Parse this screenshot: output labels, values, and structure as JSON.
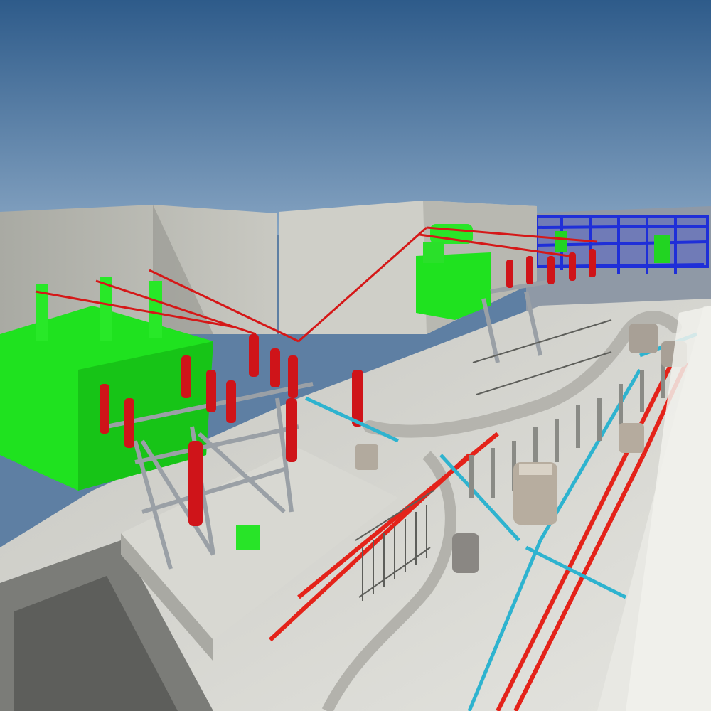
{
  "scene": {
    "palette": {
      "sky_top": "#2f5f8e",
      "sky_bottom": "#7d9cbc",
      "concrete": "#c9c9c2",
      "concrete_dark": "#8e8f88",
      "floor": "#dadad4",
      "equipment_green": "#1ee61e",
      "insulator_red": "#d2151a",
      "pipe_red": "#e6261c",
      "pipe_cyan": "#2fb6d0",
      "steel": "#9da3a8",
      "blue_structure": "#2233e0",
      "cable_tray": "#b9b8b2"
    },
    "elements": [
      "sky",
      "concrete-wall-left",
      "concrete-wall-center",
      "transformer-left",
      "transformer-right",
      "steel-gantry",
      "red-insulators",
      "blue-steel-structure",
      "cable-tray",
      "floor-slab",
      "red-conduits",
      "cyan-conduits",
      "support-posts",
      "railing",
      "lower-level"
    ]
  }
}
